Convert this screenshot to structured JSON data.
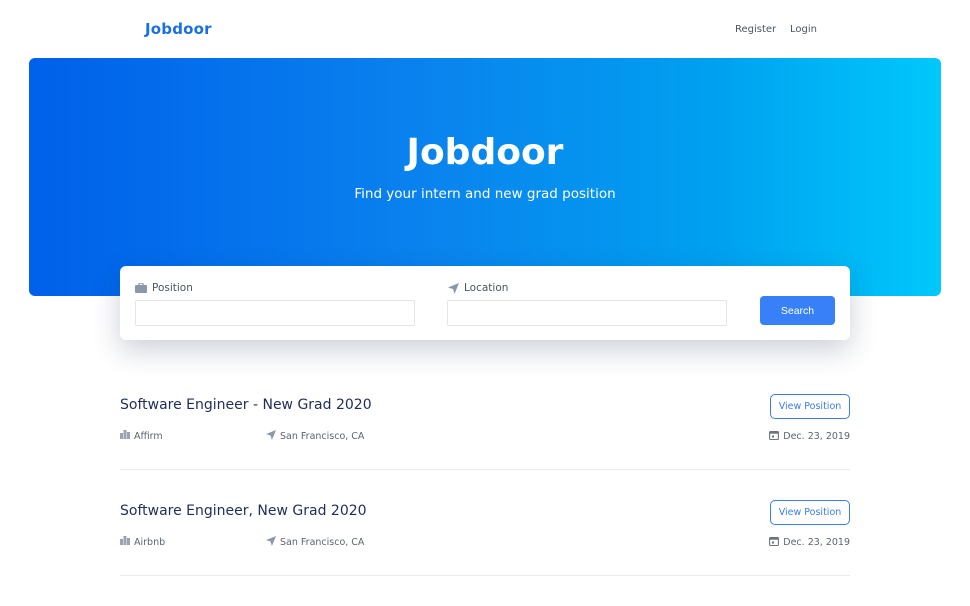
{
  "nav": {
    "brand": "Jobdoor",
    "links": [
      {
        "label": "Register"
      },
      {
        "label": "Login"
      }
    ]
  },
  "hero": {
    "title": "Jobdoor",
    "subtitle": "Find your intern and new grad position",
    "gradient_start": "#0060ea",
    "gradient_end": "#00c8fb"
  },
  "search": {
    "position_label": "Position",
    "position_icon": "briefcase-icon",
    "position_value": "",
    "location_label": "Location",
    "location_icon": "location-arrow-icon",
    "location_value": "",
    "button_label": "Search",
    "accent": "#3880f8"
  },
  "jobs": [
    {
      "title": "Software Engineer - New Grad 2020",
      "company": "Affirm",
      "location": "San Francisco, CA",
      "date": "Dec. 23, 2019",
      "button_label": "View Position"
    },
    {
      "title": "Software Engineer, New Grad 2020",
      "company": "Airbnb",
      "location": "San Francisco, CA",
      "date": "Dec. 23, 2019",
      "button_label": "View Position"
    }
  ]
}
